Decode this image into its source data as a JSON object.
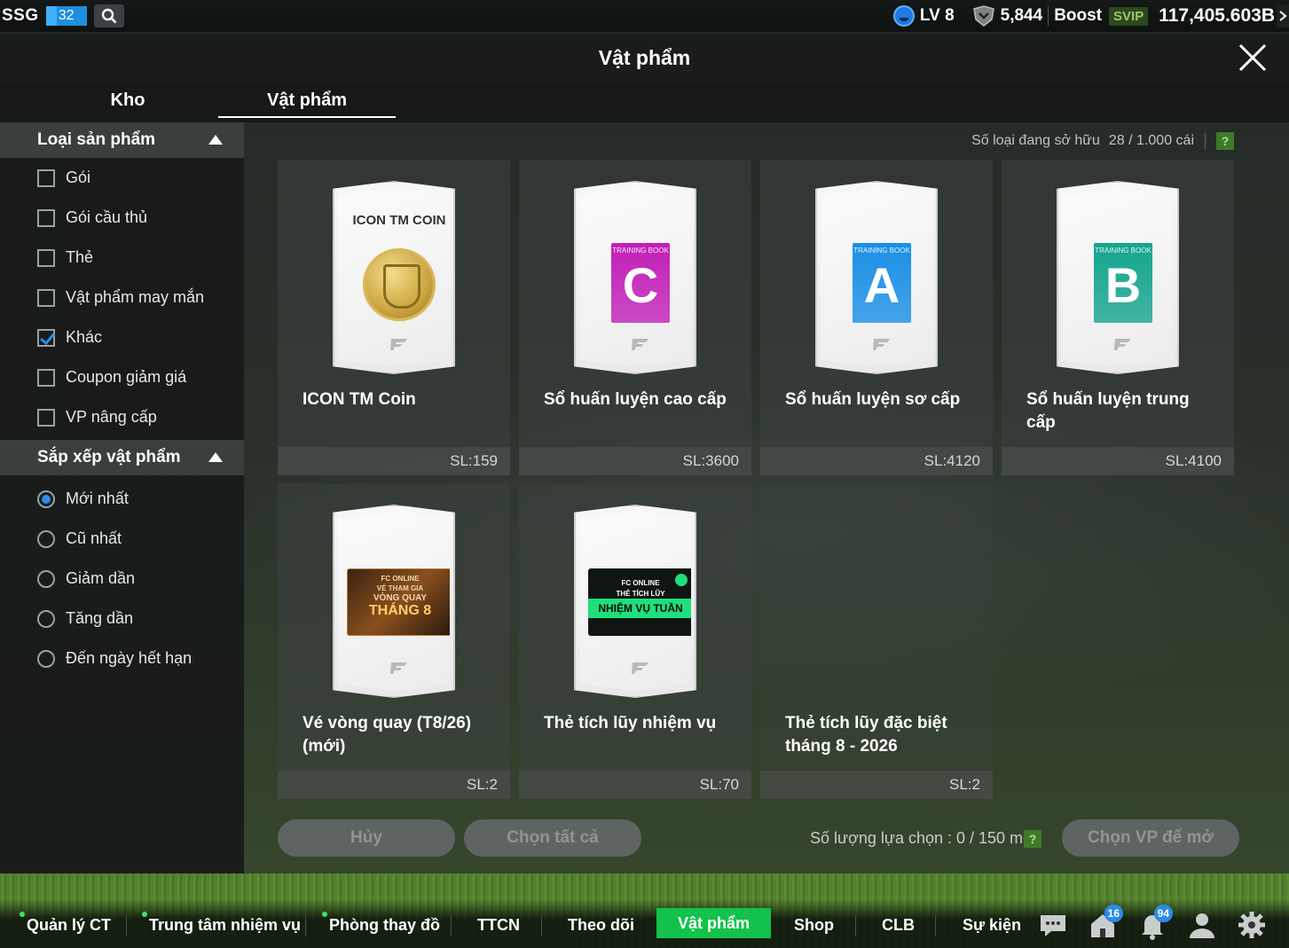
{
  "status": {
    "brand": "SSG",
    "level_badge": "32",
    "lv": "LV 8",
    "points": "5,844",
    "boost_label": "Boost",
    "svip": "SVIP",
    "balance": "117,405.603B"
  },
  "modal": {
    "title": "Vật phẩm",
    "tabs": [
      "Kho",
      "Vật phẩm"
    ],
    "active_tab": "Vật phẩm"
  },
  "sidebar": {
    "category_title": "Loại sản phẩm",
    "categories": [
      {
        "label": "Gói",
        "checked": false
      },
      {
        "label": "Gói cầu thủ",
        "checked": false
      },
      {
        "label": "Thẻ",
        "checked": false
      },
      {
        "label": "Vật phẩm may mắn",
        "checked": false
      },
      {
        "label": "Khác",
        "checked": true
      },
      {
        "label": "Coupon giảm giá",
        "checked": false
      },
      {
        "label": "VP nâng cấp",
        "checked": false
      }
    ],
    "sort_title": "Sắp xếp vật phẩm",
    "sorts": [
      {
        "label": "Mới nhất",
        "selected": true
      },
      {
        "label": "Cũ nhất",
        "selected": false
      },
      {
        "label": "Giảm dần",
        "selected": false
      },
      {
        "label": "Tăng dần",
        "selected": false
      },
      {
        "label": "Đến ngày hết hạn",
        "selected": false
      }
    ]
  },
  "content": {
    "owned_label": "Số loại đang sở hữu",
    "owned_count": "28 / 1.000 cái",
    "help": "?",
    "items": [
      {
        "name": "ICON TM Coin",
        "qty": "SL:159",
        "art": "coin",
        "art_title": "ICON TM COIN"
      },
      {
        "name": "Sổ huấn luyện cao cấp",
        "qty": "SL:3600",
        "art": "book",
        "book_label": "TRAINING BOOK",
        "book_letter": "C",
        "color": "#c21fb8"
      },
      {
        "name": "Sổ huấn luyện sơ cấp",
        "qty": "SL:4120",
        "art": "book",
        "book_label": "TRAINING BOOK",
        "book_letter": "A",
        "color": "#1a8fe6"
      },
      {
        "name": "Sổ huấn luyện trung cấp",
        "qty": "SL:4100",
        "art": "book",
        "book_label": "TRAINING BOOK",
        "book_letter": "B",
        "color": "#14a58e"
      },
      {
        "name": "Vé vòng quay (T8/26) (mới)",
        "qty": "SL:2",
        "art": "ticket",
        "t1": "FC ONLINE",
        "t2": "VÉ THAM GIA",
        "t3": "VÒNG QUAY",
        "t4": "THÁNG 8"
      },
      {
        "name": "Thẻ tích lũy nhiệm vụ",
        "qty": "SL:70",
        "art": "mission",
        "m1": "FC ONLINE",
        "m2": "THẺ TÍCH LŨY",
        "m3": "NHIỆM VỤ TUẦN"
      },
      {
        "name": "Thẻ tích lũy đặc biệt tháng 8 - 2026",
        "qty": "SL:2",
        "art": "none"
      }
    ],
    "cancel": "Hủy",
    "select_all": "Chọn tất cả",
    "selection_count": "Số lượng lựa chọn : 0 / 150 món",
    "open_button": "Chọn VP để mở"
  },
  "bottom_nav": {
    "items": [
      "Quản lý CT",
      "Trung tâm nhiệm vụ",
      "Phòng thay đồ",
      "TTCN",
      "Theo dõi",
      "Vật phẩm",
      "Shop",
      "CLB",
      "Sự kiện"
    ],
    "active": "Vật phẩm",
    "home_badge": "16",
    "bell_badge": "94"
  }
}
